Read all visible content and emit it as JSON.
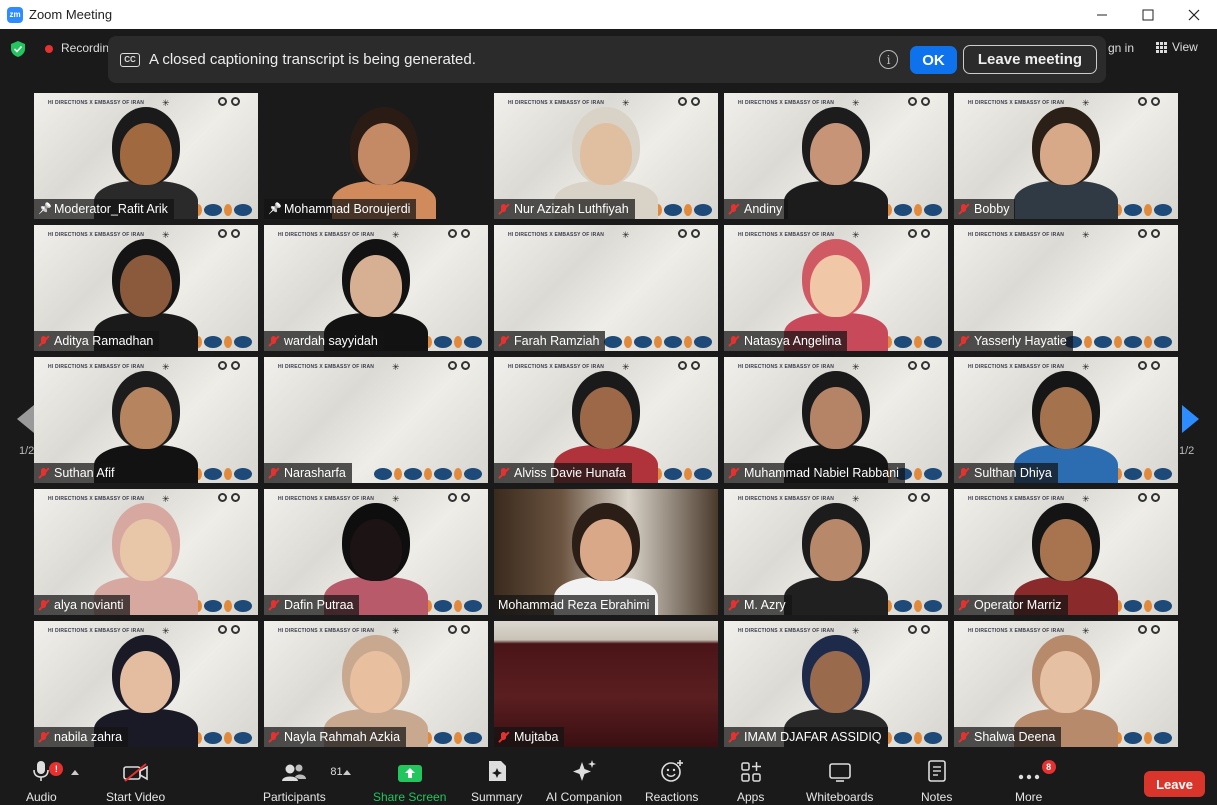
{
  "window": {
    "title": "Zoom Meeting",
    "logo_text": "zm"
  },
  "top": {
    "recording_label": "Recording",
    "signin_label": "gn in",
    "view_label": "View"
  },
  "banner": {
    "cc_label": "CC",
    "message": "A closed captioning transcript is being generated.",
    "info_glyph": "i",
    "ok_label": "OK",
    "leave_label": "Leave meeting"
  },
  "brand": {
    "left": "HI DIRECTIONS   X   EMBASSY OF IRAN",
    "star": "✳"
  },
  "participants": [
    {
      "name": "Moderator_Rafit Arik",
      "status": "pinned",
      "bg": "paper",
      "active": true,
      "skin": "#a0693f",
      "hair": "#1a1a1a",
      "shirt": "#2a2a2a"
    },
    {
      "name": "Mohammad Boroujerdi",
      "status": "pinned",
      "bg": "dark",
      "skin": "#c48a66",
      "hair": "#2a1c14",
      "shirt": "#d08a5c"
    },
    {
      "name": "Nur Azizah Luthfiyah",
      "status": "muted",
      "bg": "paper",
      "skin": "#e0bfa0",
      "hair": "#d9d2c6",
      "shirt": "#d9d2c6"
    },
    {
      "name": "Andiny",
      "status": "muted",
      "bg": "paper",
      "skin": "#c79478",
      "hair": "#1c1c1c",
      "shirt": "#1c1c1c"
    },
    {
      "name": "Bobby",
      "status": "muted",
      "bg": "paper",
      "skin": "#d7a988",
      "hair": "#2a2018",
      "shirt": "#2f3a44"
    },
    {
      "name": "Aditya Ramadhan",
      "status": "muted",
      "bg": "paper",
      "skin": "#8b5a3c",
      "hair": "#141414",
      "shirt": "#1a1a1a"
    },
    {
      "name": "wardah sayyidah",
      "status": "muted",
      "bg": "paper",
      "skin": "#d7b093",
      "hair": "#121212",
      "shirt": "#121212"
    },
    {
      "name": "Farah Ramziah",
      "status": "muted",
      "bg": "paper",
      "skin": "",
      "hair": "",
      "shirt": ""
    },
    {
      "name": "Natasya Angelina",
      "status": "muted",
      "bg": "paper",
      "skin": "#f0c8a8",
      "hair": "#d05a64",
      "shirt": "#c84a5a"
    },
    {
      "name": "Yasserly Hayatie",
      "status": "muted",
      "bg": "paper",
      "skin": "",
      "hair": "",
      "shirt": ""
    },
    {
      "name": "Suthan Afif",
      "status": "muted",
      "bg": "paper",
      "skin": "#b78460",
      "hair": "#1c1c1c",
      "shirt": "#121212"
    },
    {
      "name": "Narasharfa",
      "status": "muted",
      "bg": "paper",
      "skin": "",
      "hair": "",
      "shirt": ""
    },
    {
      "name": "Alviss Davie Hunafa",
      "status": "muted",
      "bg": "paper",
      "skin": "#9c6848",
      "hair": "#1a1a1a",
      "shirt": "#b0323a"
    },
    {
      "name": "Muhammad Nabiel Rabbani",
      "status": "muted",
      "bg": "paper",
      "skin": "#b58466",
      "hair": "#1a1a1a",
      "shirt": "#151515"
    },
    {
      "name": "Sulthan Dhiya",
      "status": "muted",
      "bg": "paper",
      "skin": "#a5724e",
      "hair": "#161616",
      "shirt": "#2c6cb0"
    },
    {
      "name": "alya novianti",
      "status": "muted",
      "bg": "paper",
      "skin": "#e8c6a8",
      "hair": "#d6a8a0",
      "shirt": "#d6a8a0"
    },
    {
      "name": "Dafin Putraa",
      "status": "muted",
      "bg": "paper",
      "skin": "#1c1414",
      "hair": "#0e0e0e",
      "shirt": "#b85a6a"
    },
    {
      "name": "Mohammad Reza Ebrahimi",
      "status": "none",
      "bg": "office",
      "skin": "#d8a888",
      "hair": "#2a1e16",
      "shirt": "#f2f2f2"
    },
    {
      "name": "M. Azry",
      "status": "muted",
      "bg": "paper",
      "skin": "#b7896a",
      "hair": "#1c1c1c",
      "shirt": "#202020"
    },
    {
      "name": "Operator Marriz",
      "status": "muted",
      "bg": "paper",
      "skin": "#a87450",
      "hair": "#141414",
      "shirt": "#8a2a2a"
    },
    {
      "name": "nabila zahra",
      "status": "muted",
      "bg": "paper",
      "skin": "#e4bda0",
      "hair": "#1a1a26",
      "shirt": "#1a1a26"
    },
    {
      "name": "Nayla Rahmah Azkia",
      "status": "muted",
      "bg": "paper",
      "skin": "#e8c0a0",
      "hair": "#c9a890",
      "shirt": "#c9a890"
    },
    {
      "name": "Mujtaba",
      "status": "muted",
      "bg": "cabinet",
      "skin": "",
      "hair": "",
      "shirt": ""
    },
    {
      "name": "IMAM DJAFAR ASSIDIQ",
      "status": "muted",
      "bg": "paper",
      "skin": "#9a6a4c",
      "hair": "#1e2a4a",
      "shirt": "#2a2a2a"
    },
    {
      "name": "Shalwa Deena",
      "status": "muted",
      "bg": "paper",
      "skin": "#e6c0a2",
      "hair": "#b88a6c",
      "shirt": "#b88a6c"
    }
  ],
  "pager": {
    "left_label": "1/2",
    "right_label": "1/2"
  },
  "toolbar": {
    "audio": {
      "label": "Audio",
      "badge": "!"
    },
    "video": {
      "label": "Start Video"
    },
    "participants": {
      "label": "Participants",
      "count": "81"
    },
    "share": {
      "label": "Share Screen"
    },
    "summary": {
      "label": "Summary"
    },
    "ai": {
      "label": "AI Companion"
    },
    "reactions": {
      "label": "Reactions"
    },
    "apps": {
      "label": "Apps"
    },
    "whiteboards": {
      "label": "Whiteboards"
    },
    "notes": {
      "label": "Notes"
    },
    "more": {
      "label": "More",
      "badge": "8"
    },
    "leave": {
      "label": "Leave"
    }
  },
  "colors": {
    "accent": "#0e72ed",
    "share_green": "#22c55e",
    "leave_red": "#d9352b",
    "active_border": "#a6e22e",
    "muted_red": "#e5312f"
  }
}
